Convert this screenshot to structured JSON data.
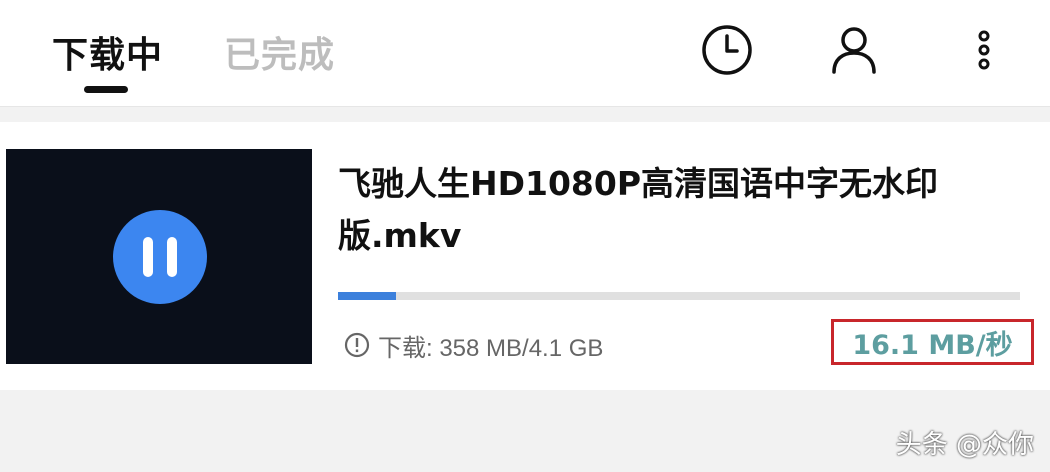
{
  "tabs": {
    "active_label": "下载中",
    "inactive_label": "已完成"
  },
  "header_icons": [
    "clock-icon",
    "user-icon",
    "more-vertical-icon"
  ],
  "download": {
    "title": "飞驰人生HD1080P高清国语中字无水印版.mkv",
    "progress_fraction": 0.085,
    "status_text": "下载: 358 MB/4.1 GB",
    "speed": "16.1 MB/秒"
  },
  "colors": {
    "accent_blue": "#3c86f0",
    "speed_text": "#5d9ea0",
    "highlight_border": "#c8262b"
  },
  "watermark": "头条 @众你"
}
